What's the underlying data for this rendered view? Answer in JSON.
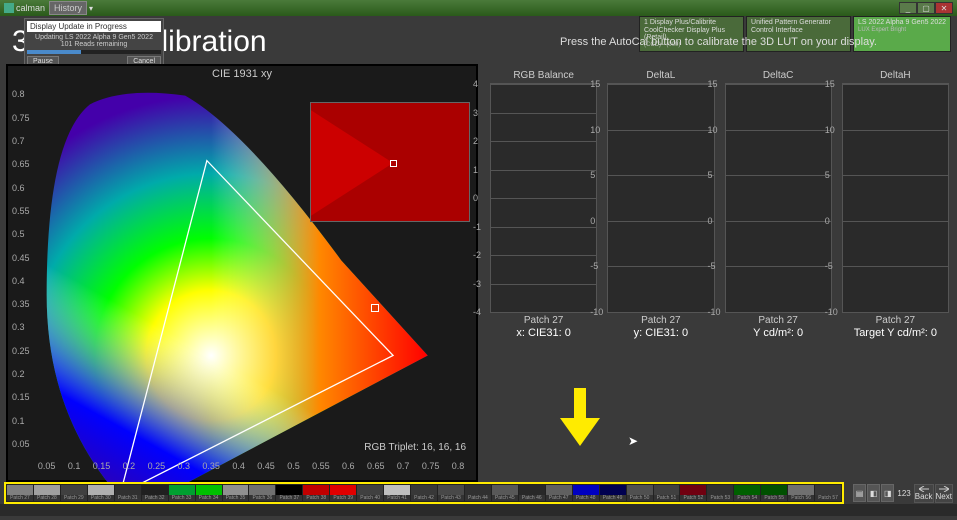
{
  "app_name": "calman",
  "history_label": "History",
  "page_title": "3D LUT Calibration",
  "instruction": "Press the AutoCal button to calibrate the 3D LUT on your display.",
  "tabs": [
    {
      "label": "1 Display Plus/Calibrite CoolChecker Display Plus (Retail)",
      "sub": "(CCD) - (000)"
    },
    {
      "label": "Unified Pattern Generator Control Interface",
      "sub": ""
    },
    {
      "label": "LS 2022 Alpha 9 Gen5 2022",
      "sub": "LUX Expert Bright"
    }
  ],
  "progress": {
    "field": "Display Update in Progress",
    "status_line1": "Updating LS 2022 Alpha 9 Gen5 2022",
    "status_line2": "101 Reads remaining",
    "pause": "Pause",
    "cancel": "Cancel"
  },
  "cie": {
    "title": "CIE 1931 xy",
    "y_ticks": [
      "0.8",
      "0.75",
      "0.7",
      "0.65",
      "0.6",
      "0.55",
      "0.5",
      "0.45",
      "0.4",
      "0.35",
      "0.3",
      "0.25",
      "0.2",
      "0.15",
      "0.1",
      "0.05"
    ],
    "x_ticks": [
      "0.05",
      "0.1",
      "0.15",
      "0.2",
      "0.25",
      "0.3",
      "0.35",
      "0.4",
      "0.45",
      "0.5",
      "0.55",
      "0.6",
      "0.65",
      "0.7",
      "0.75",
      "0.8"
    ],
    "rgb_triplet": "RGB Triplet: 16, 16, 16"
  },
  "charts": [
    {
      "title": "RGB Balance",
      "ticks": [
        "4",
        "3",
        "2",
        "1",
        "0",
        "-1",
        "-2",
        "-3",
        "-4"
      ],
      "sub": "Patch 27",
      "value": "x: CIE31: 0"
    },
    {
      "title": "DeltaL",
      "ticks": [
        "15",
        "10",
        "5",
        "0",
        "-5",
        "-10"
      ],
      "sub": "Patch 27",
      "value": "y: CIE31: 0"
    },
    {
      "title": "DeltaC",
      "ticks": [
        "15",
        "10",
        "5",
        "0",
        "-5",
        "-10"
      ],
      "sub": "Patch 27",
      "value": "Y cd/m²: 0"
    },
    {
      "title": "DeltaH",
      "ticks": [
        "15",
        "10",
        "5",
        "0",
        "-5",
        "-10"
      ],
      "sub": "Patch 27",
      "value": "Target Y cd/m²: 0"
    }
  ],
  "patches": [
    {
      "c": "#808080",
      "l": "Patch 27"
    },
    {
      "c": "#a0a0a0",
      "l": "Patch 28"
    },
    {
      "c": "#404040",
      "l": "Patch 29"
    },
    {
      "c": "#b0b0b0",
      "l": "Patch 30"
    },
    {
      "c": "#303030",
      "l": "Patch 31"
    },
    {
      "c": "#202020",
      "l": "Patch 32"
    },
    {
      "c": "#00a030",
      "l": "Patch 33"
    },
    {
      "c": "#00c000",
      "l": "Patch 34"
    },
    {
      "c": "#909090",
      "l": "Patch 35"
    },
    {
      "c": "#707070",
      "l": "Patch 36"
    },
    {
      "c": "#000000",
      "l": "Patch 37"
    },
    {
      "c": "#c00000",
      "l": "Patch 38"
    },
    {
      "c": "#e00000",
      "l": "Patch 39"
    },
    {
      "c": "#404040",
      "l": "Patch 40"
    },
    {
      "c": "#c0c0c0",
      "l": "Patch 41"
    },
    {
      "c": "#383838",
      "l": "Patch 42"
    },
    {
      "c": "#484848",
      "l": "Patch 43"
    },
    {
      "c": "#303030",
      "l": "Patch 44"
    },
    {
      "c": "#585858",
      "l": "Patch 45"
    },
    {
      "c": "#282828",
      "l": "Patch 46"
    },
    {
      "c": "#606060",
      "l": "Patch 47"
    },
    {
      "c": "#0000c0",
      "l": "Patch 48"
    },
    {
      "c": "#000050",
      "l": "Patch 49"
    },
    {
      "c": "#505050",
      "l": "Patch 50"
    },
    {
      "c": "#404040",
      "l": "Patch 51"
    },
    {
      "c": "#700010",
      "l": "Patch 52"
    },
    {
      "c": "#303030",
      "l": "Patch 53"
    },
    {
      "c": "#006000",
      "l": "Patch 54"
    },
    {
      "c": "#005000",
      "l": "Patch 55"
    },
    {
      "c": "#707070",
      "l": "Patch 56"
    },
    {
      "c": "#383838",
      "l": "Patch 57"
    }
  ],
  "chart_data": {
    "type": "scatter",
    "title": "CIE 1931 xy",
    "xlabel": "x",
    "ylabel": "y",
    "xlim": [
      0,
      0.8
    ],
    "ylim": [
      0,
      0.85
    ],
    "target_point": {
      "x": 0.64,
      "y": 0.33
    },
    "panels": [
      {
        "name": "RGB Balance",
        "type": "bar",
        "categories": [
          "Patch 27"
        ],
        "values": [
          0
        ],
        "ylim": [
          -4,
          4
        ]
      },
      {
        "name": "DeltaL",
        "type": "bar",
        "categories": [
          "Patch 27"
        ],
        "values": [
          0
        ],
        "ylim": [
          -10,
          15
        ]
      },
      {
        "name": "DeltaC",
        "type": "bar",
        "categories": [
          "Patch 27"
        ],
        "values": [
          0
        ],
        "ylim": [
          -10,
          15
        ]
      },
      {
        "name": "DeltaH",
        "type": "bar",
        "categories": [
          "Patch 27"
        ],
        "values": [
          0
        ],
        "ylim": [
          -10,
          15
        ]
      }
    ]
  },
  "nav": {
    "count": "123",
    "back": "Back",
    "next": "Next"
  }
}
